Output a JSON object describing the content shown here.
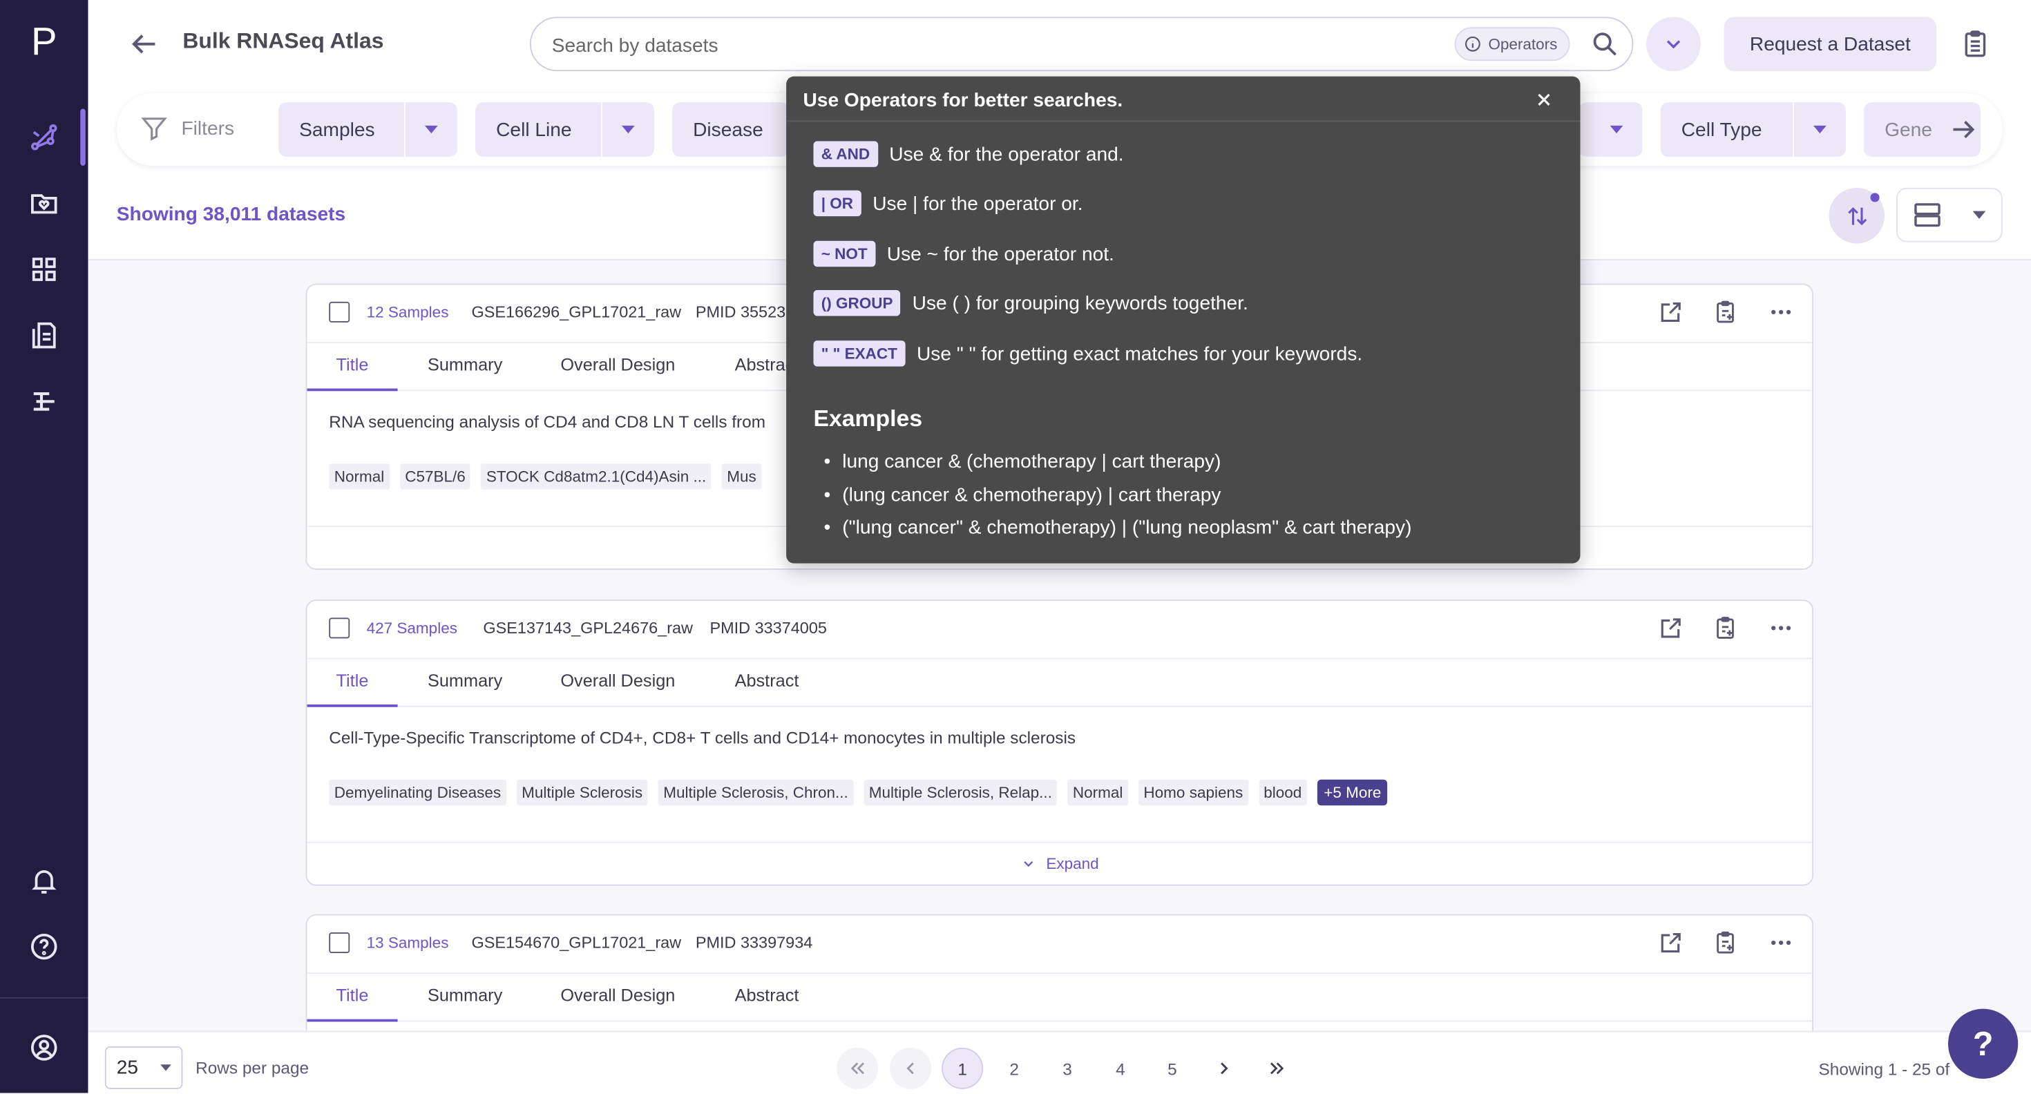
{
  "app": {
    "logo": "P",
    "title": "Bulk RNASeq Atlas"
  },
  "search": {
    "placeholder": "Search by datasets",
    "operators_label": "Operators"
  },
  "header": {
    "request_button": "Request a Dataset"
  },
  "filters": {
    "label": "Filters",
    "chips": [
      "Samples",
      "Cell Line",
      "Disease",
      "Cell Type",
      "Gene"
    ]
  },
  "results": {
    "showing": "Showing 38,011 datasets"
  },
  "operators_popover": {
    "title": "Use Operators for better searches.",
    "operators": [
      {
        "badge": "& AND",
        "desc": "Use & for the operator and."
      },
      {
        "badge": "| OR",
        "desc": "Use | for the operator or."
      },
      {
        "badge": "~ NOT",
        "desc": "Use ~ for the operator not."
      },
      {
        "badge": "() GROUP",
        "desc": "Use ( ) for grouping keywords together."
      },
      {
        "badge": "\" \" EXACT",
        "desc": "Use \" \" for getting exact matches for your keywords."
      }
    ],
    "examples_title": "Examples",
    "examples": [
      "lung cancer & (chemotherapy | cart therapy)",
      "(lung cancer & chemotherapy) | cart therapy",
      "(\"lung cancer\" & chemotherapy) | (\"lung neoplasm\" & cart therapy)"
    ]
  },
  "tabs": [
    "Title",
    "Summary",
    "Overall Design",
    "Abstract"
  ],
  "cards": [
    {
      "samples": "12 Samples",
      "gse": "GSE166296_GPL17021_raw",
      "pmid": "PMID 35523",
      "title": "RNA sequencing analysis of CD4 and CD8 LN T cells from",
      "tags": [
        "Normal",
        "C57BL/6",
        "STOCK Cd8atm2.1(Cd4)Asin ...",
        "Mus"
      ]
    },
    {
      "samples": "427 Samples",
      "gse": "GSE137143_GPL24676_raw",
      "pmid": "PMID 33374005",
      "title": "Cell-Type-Specific Transcriptome of CD4+, CD8+ T cells and CD14+ monocytes in multiple sclerosis",
      "tags": [
        "Demyelinating Diseases",
        "Multiple Sclerosis",
        "Multiple Sclerosis, Chron...",
        "Multiple Sclerosis, Relap...",
        "Normal",
        "Homo sapiens",
        "blood"
      ],
      "more": "+5 More",
      "expand": "Expand"
    },
    {
      "samples": "13 Samples",
      "gse": "GSE154670_GPL17021_raw",
      "pmid": "PMID 33397934"
    }
  ],
  "pagination": {
    "rows_value": "25",
    "rows_label": "Rows per page",
    "pages": [
      "1",
      "2",
      "3",
      "4",
      "5"
    ],
    "showing": "Showing 1 - 25 of"
  },
  "help_fab": "?",
  "colors": {
    "sidebar": "#221d3f",
    "accent": "#6f54c7",
    "chip_bg": "#ece8f8",
    "popover_bg": "#4a4a4a"
  }
}
